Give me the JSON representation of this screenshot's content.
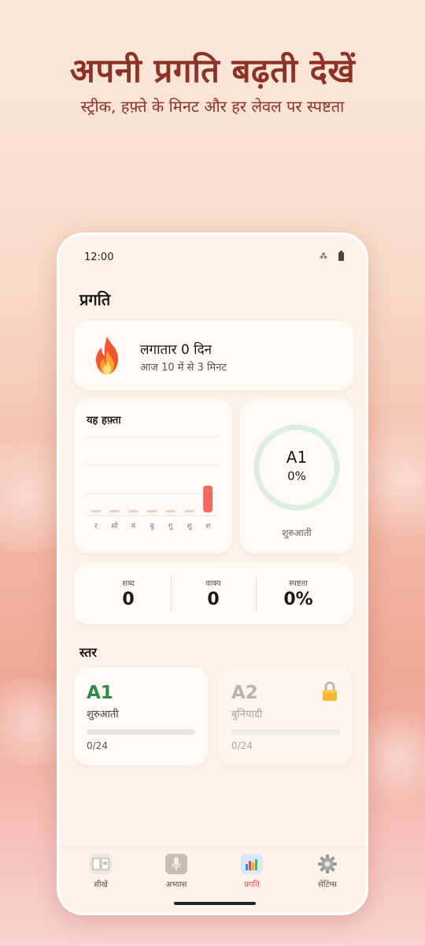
{
  "hero": {
    "title": "अपनी प्रगति बढ़ती देखें",
    "subtitle": "स्ट्रीक, हफ़्ते के मिनट और हर लेवल पर स्पष्टता"
  },
  "status_bar": {
    "time": "12:00"
  },
  "page": {
    "title": "प्रगति"
  },
  "streak": {
    "icon": "flame-icon",
    "title": "लगातार 0 दिन",
    "subtitle": "आज 10 में से 3 मिनट"
  },
  "week": {
    "title": "यह हफ़्ता",
    "chart_data": {
      "type": "bar",
      "categories": [
        "र",
        "सो",
        "मं",
        "बु",
        "गु",
        "शु",
        "श"
      ],
      "values": [
        0,
        0,
        0,
        0,
        0,
        0,
        3
      ],
      "title": "यह हफ़्ता",
      "xlabel": "",
      "ylabel": "",
      "grid": true,
      "highlight_color": "#f06a60",
      "empty_color": "#f7c9c2"
    }
  },
  "current_level": {
    "code": "A1",
    "percent": "0%",
    "progress_fraction": 0,
    "label": "शुरुआती"
  },
  "stats": {
    "words_label": "शब्द",
    "words_value": "0",
    "sentences_label": "वाक्य",
    "sentences_value": "0",
    "clarity_label": "स्पष्टता",
    "clarity_value": "0%"
  },
  "levels": {
    "heading": "स्तर",
    "items": [
      {
        "code": "A1",
        "name": "शुरुआती",
        "count": "0/24",
        "progress_fraction": 0,
        "locked": false,
        "color": "#2e8b4a"
      },
      {
        "code": "A2",
        "name": "बुनियादी",
        "count": "0/24",
        "progress_fraction": 0,
        "locked": true,
        "color": "#b9b3ad"
      }
    ]
  },
  "nav": {
    "items": [
      {
        "label": "सीखें",
        "icon": "book-icon",
        "active": false
      },
      {
        "label": "अभ्यास",
        "icon": "microphone-icon",
        "active": false
      },
      {
        "label": "प्रगति",
        "icon": "bar-chart-icon",
        "active": true
      },
      {
        "label": "सेटिंग्स",
        "icon": "gear-icon",
        "active": false
      }
    ]
  },
  "colors": {
    "brand_title": "#8e3227",
    "accent": "#e0514a",
    "success": "#2e8b4a",
    "ring_track": "#dcefe1"
  }
}
